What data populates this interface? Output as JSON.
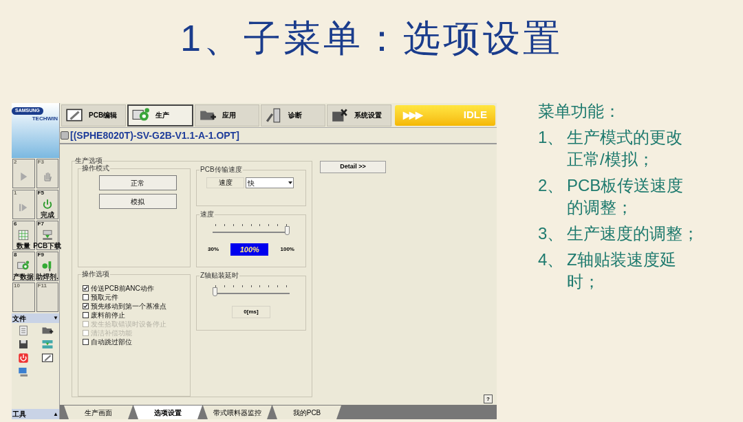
{
  "slide": {
    "title": "1、子菜单：选项设置"
  },
  "app": {
    "logo": {
      "brand": "SAMSUNG",
      "sub": "TECHWIN"
    },
    "toolbar": [
      {
        "label": "PCB编辑",
        "kind": "edit",
        "selected": false
      },
      {
        "label": "生产",
        "kind": "gear",
        "selected": true
      },
      {
        "label": "应用",
        "kind": "folder",
        "selected": false
      },
      {
        "label": "诊断",
        "kind": "probe",
        "selected": false
      },
      {
        "label": "系统设置",
        "kind": "tools",
        "selected": false
      }
    ],
    "status": {
      "arrows": "▶▶▶",
      "text": "IDLE"
    },
    "file_name": "[(SPHE8020T)-SV-G2B-V1.1-A-1.OPT]",
    "function_keys": [
      {
        "key": "2",
        "kind": "play",
        "disabled": true
      },
      {
        "key": "F3",
        "kind": "hand",
        "disabled": true
      },
      {
        "key": "1",
        "kind": "step",
        "disabled": true
      },
      {
        "key": "F5",
        "caption": "完成",
        "kind": "power",
        "disabled": false
      },
      {
        "key": "6",
        "caption": "数量",
        "kind": "grid",
        "disabled": false
      },
      {
        "key": "F7",
        "caption": "PCB下载",
        "kind": "download",
        "disabled": false
      },
      {
        "key": "8",
        "caption": "产数据",
        "kind": "gear",
        "disabled": false
      },
      {
        "key": "F9",
        "caption": "助焊剂.",
        "kind": "glue",
        "disabled": false
      },
      {
        "key": "10",
        "kind": "blank",
        "disabled": true
      },
      {
        "key": "F11",
        "kind": "blank",
        "disabled": true
      }
    ],
    "file_section": {
      "title": "文件",
      "arrow": "▼"
    },
    "tools_section": {
      "title": "工具",
      "arrow": "▲"
    },
    "options": {
      "title": "生产选项",
      "mode": {
        "title": "操作模式",
        "buttons": [
          "正常",
          "模拟"
        ]
      },
      "pcb_speed": {
        "title": "PCB传输速度",
        "label": "速度",
        "value": "快"
      },
      "speed": {
        "title": "速度",
        "level": 1,
        "min": "30%",
        "reading": "100%",
        "max": "100%"
      },
      "z_delay": {
        "title": "Z轴贴装延时",
        "level": 0,
        "reading": "0[ms]"
      },
      "checks": {
        "title": "操作选项",
        "items": [
          {
            "label": "传送PCB前ANC动作",
            "checked": true,
            "disabled": false
          },
          {
            "label": "预取元件",
            "checked": false,
            "disabled": false
          },
          {
            "label": "预先移动到第一个基准点",
            "checked": true,
            "disabled": false
          },
          {
            "label": "废料前停止",
            "checked": false,
            "disabled": false
          },
          {
            "label": "发生拾取错误时设备停止",
            "checked": false,
            "disabled": true
          },
          {
            "label": "清洁补偿功能",
            "checked": false,
            "disabled": true
          },
          {
            "label": "自动跳过部位",
            "checked": false,
            "disabled": false
          }
        ]
      }
    },
    "detail_button": "Detail >>",
    "help_button": "?",
    "bottom_tabs": [
      {
        "label": "生产画面",
        "selected": false
      },
      {
        "label": "选项设置",
        "selected": true
      },
      {
        "label": "带式喂料器监控",
        "selected": false
      },
      {
        "label": "我的PCB",
        "selected": false
      }
    ]
  },
  "notes": {
    "heading": "菜单功能：",
    "items": [
      {
        "number": "1、",
        "lines": [
          "生产模式的更改",
          "正常/模拟；"
        ]
      },
      {
        "number": "2、",
        "lines": [
          "PCB板传送速度",
          "的调整；"
        ]
      },
      {
        "number": "3、",
        "lines": [
          "生产速度的调整；"
        ]
      },
      {
        "number": "4、",
        "lines": [
          "Z轴贴装速度延",
          "时；"
        ]
      }
    ]
  }
}
